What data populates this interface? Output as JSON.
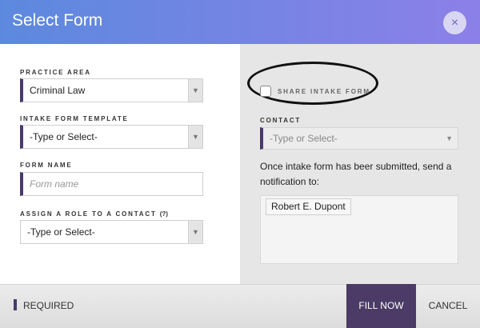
{
  "header": {
    "title": "Select Form",
    "close_icon": "×"
  },
  "form": {
    "practice_area": {
      "label": "PRACTICE AREA",
      "value": "Criminal Law"
    },
    "template": {
      "label": "INTAKE FORM TEMPLATE",
      "value": "-Type or Select-"
    },
    "form_name": {
      "label": "FORM NAME",
      "placeholder": "Form name"
    },
    "assign_role": {
      "label": "ASSIGN A ROLE TO A CONTACT",
      "help": "(?)",
      "value": "-Type or Select-"
    }
  },
  "share": {
    "checkbox_label": "SHARE INTAKE FORM",
    "checked": false,
    "contact_label": "CONTACT",
    "contact_value": "-Type or Select-",
    "notify_text": "Once intake form has beer submitted, send a notification to:",
    "recipients": [
      "Robert E. Dupont"
    ]
  },
  "footer": {
    "required_label": "REQUIRED",
    "fill_label": "FILL NOW",
    "cancel_label": "CANCEL"
  },
  "colors": {
    "header_start": "#5c89de",
    "header_end": "#8c80e8",
    "accent": "#4a3a6b",
    "fill_button": "#4b3b66"
  }
}
